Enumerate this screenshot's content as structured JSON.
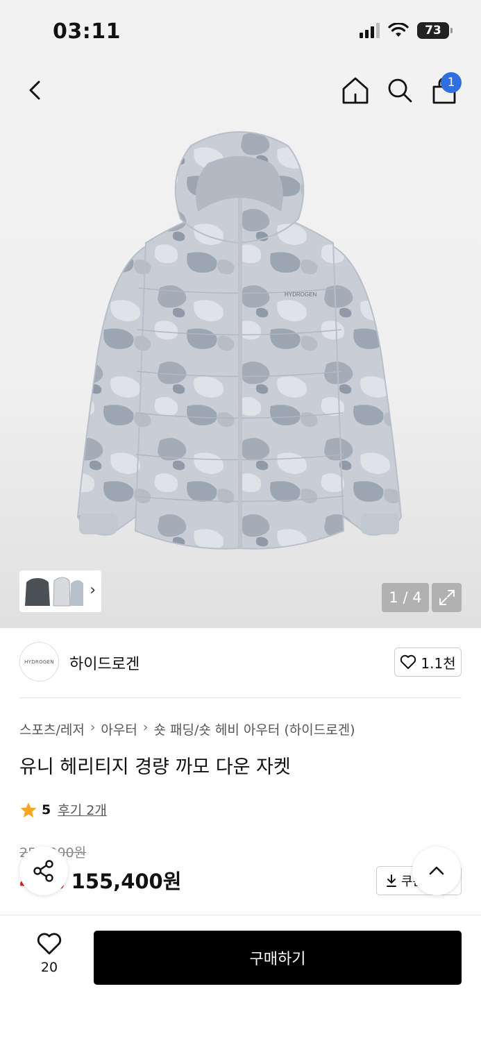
{
  "status_bar": {
    "time": "03:11",
    "battery": "73"
  },
  "nav": {
    "cart_count": "1"
  },
  "gallery": {
    "counter": "1 / 4",
    "image_brand_text": "HYDROGEN"
  },
  "brand": {
    "logo_text": "HYDROGEN",
    "name": "하이드로겐",
    "likes": "1.1천"
  },
  "breadcrumb": [
    "스포츠/레저",
    "아우터",
    "숏 패딩/숏 헤비 아우터 (하이드로겐)"
  ],
  "product": {
    "title": "유니 헤리티지 경량 까모 다운 자켓",
    "rating": "5",
    "reviews": "후기 2개",
    "original_price": "259,000원",
    "discount": "40%",
    "price": "155,400원",
    "coupon_label": "쿠폰"
  },
  "bottom_bar": {
    "wish_count": "20",
    "buy_label": "구매하기"
  },
  "colors": {
    "accent_blue": "#2f6fe0",
    "discount_red": "#e0201b",
    "star": "#f5a623",
    "button_black": "#000000"
  }
}
